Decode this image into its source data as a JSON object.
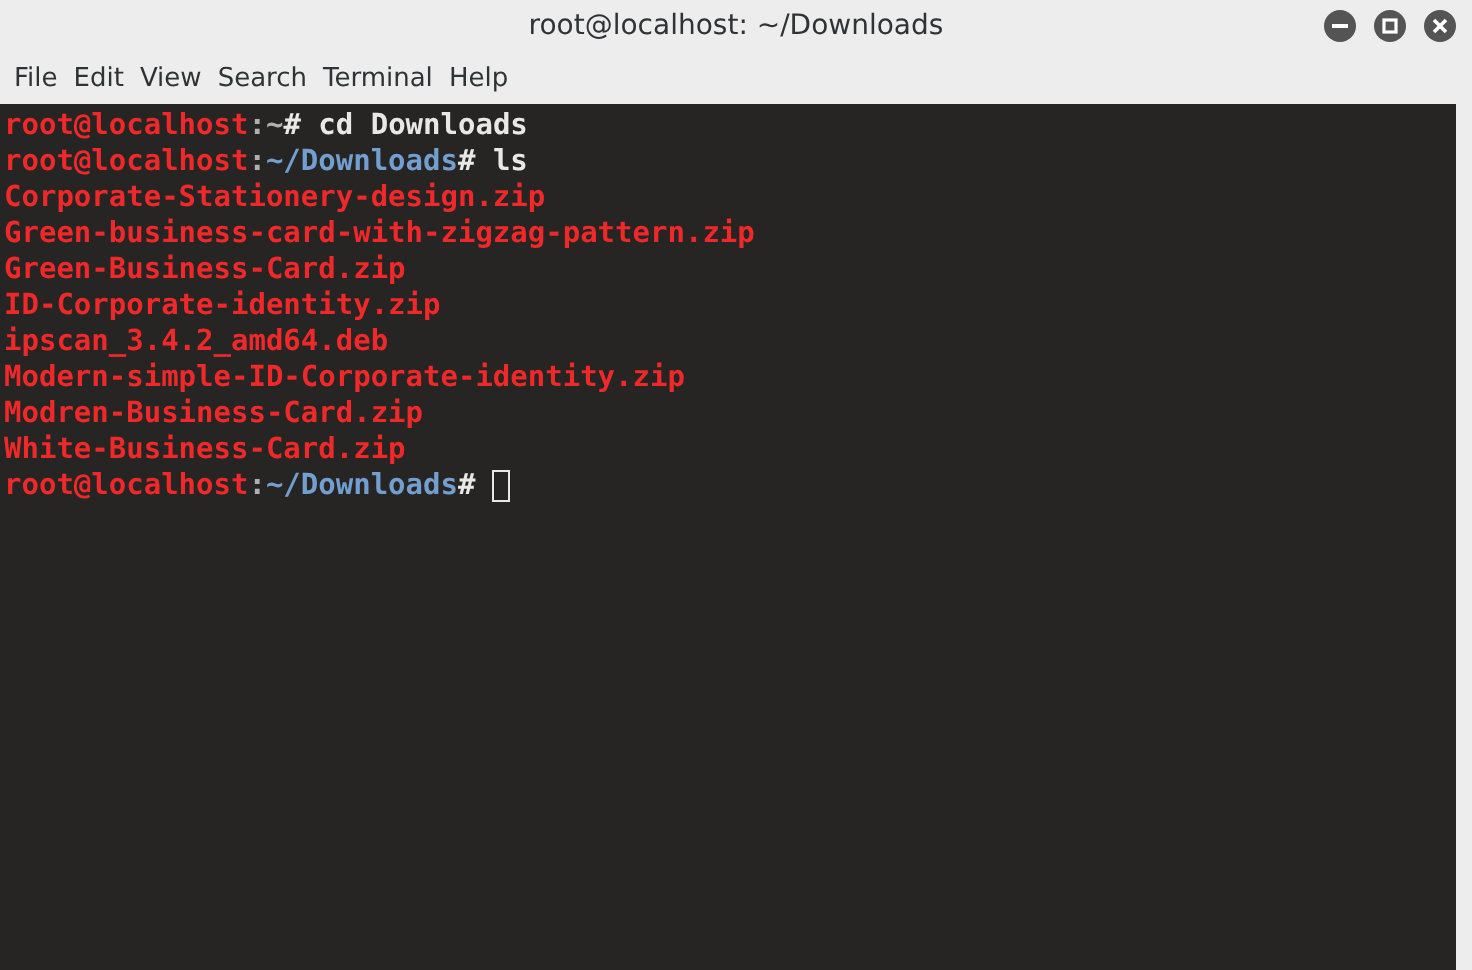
{
  "window": {
    "title": "root@localhost: ~/Downloads"
  },
  "menu": [
    "File",
    "Edit",
    "View",
    "Search",
    "Terminal",
    "Help"
  ],
  "terminal": {
    "lines": [
      {
        "segments": [
          {
            "kind": "user",
            "text": "root@localhost"
          },
          {
            "kind": "sep",
            "text": ":~"
          },
          {
            "kind": "cmd",
            "text": "# cd Downloads"
          }
        ]
      },
      {
        "segments": [
          {
            "kind": "user",
            "text": "root@localhost"
          },
          {
            "kind": "sep",
            "text": ":"
          },
          {
            "kind": "path",
            "text": "~/Downloads"
          },
          {
            "kind": "cmd",
            "text": "# ls"
          }
        ]
      },
      {
        "segments": [
          {
            "kind": "file",
            "text": "Corporate-Stationery-design.zip"
          }
        ]
      },
      {
        "segments": [
          {
            "kind": "file",
            "text": "Green-business-card-with-zigzag-pattern.zip"
          }
        ]
      },
      {
        "segments": [
          {
            "kind": "file",
            "text": "Green-Business-Card.zip"
          }
        ]
      },
      {
        "segments": [
          {
            "kind": "file",
            "text": "ID-Corporate-identity.zip"
          }
        ]
      },
      {
        "segments": [
          {
            "kind": "file",
            "text": "ipscan_3.4.2_amd64.deb"
          }
        ]
      },
      {
        "segments": [
          {
            "kind": "file",
            "text": "Modern-simple-ID-Corporate-identity.zip"
          }
        ]
      },
      {
        "segments": [
          {
            "kind": "file",
            "text": "Modren-Business-Card.zip"
          }
        ]
      },
      {
        "segments": [
          {
            "kind": "file",
            "text": "White-Business-Card.zip"
          }
        ]
      },
      {
        "segments": [
          {
            "kind": "user",
            "text": "root@localhost"
          },
          {
            "kind": "sep",
            "text": ":"
          },
          {
            "kind": "path",
            "text": "~/Downloads"
          },
          {
            "kind": "cmd",
            "text": "# "
          }
        ],
        "cursor": true
      }
    ]
  }
}
